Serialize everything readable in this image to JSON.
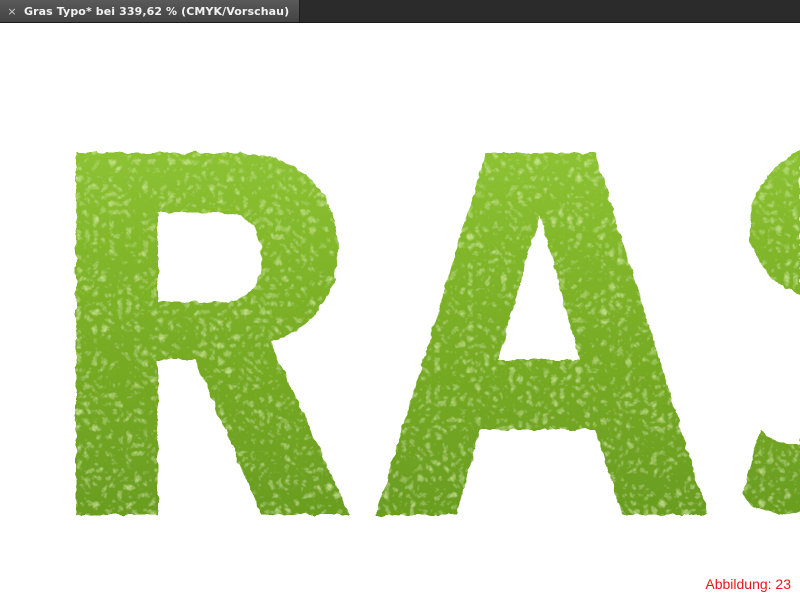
{
  "window": {
    "tab_title": "Gras Typo* bei 339,62 % (CMYK/Vorschau)",
    "close_glyph": "×"
  },
  "artwork": {
    "text": "GRAS",
    "fill_color": "#7cb126",
    "texture": "grass"
  },
  "caption": "Abbildung: 23",
  "colors": {
    "tabbar_bg": "#2b2b2b",
    "caption": "#e8161b",
    "grass_light": "#9acd3c",
    "grass_dark": "#5a8a1a"
  }
}
